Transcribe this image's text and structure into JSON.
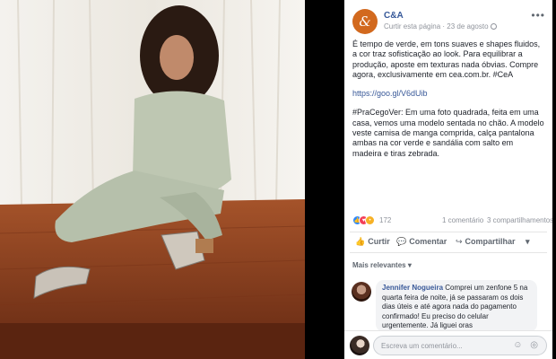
{
  "post": {
    "page_name": "C&A",
    "logo_glyph": "&",
    "follow_label": "Curtir esta página",
    "date": "23 de agosto",
    "separator": " · ",
    "text_paragraphs": [
      "É tempo de verde, em tons suaves e shapes fluidos, a cor traz sofisticação ao look. Para equilibrar a produção, aposte em texturas nada óbvias. Compre agora, exclusivamente em cea.com.br. #CeA",
      "https://goo.gl/V6dUib",
      "#PraCegoVer: Em uma foto quadrada, feita em uma casa, vemos uma modelo sentada no chão. A modelo veste camisa de manga comprida, calça pantalona ambas na cor verde e sandália com salto em madeira e tiras zebrada."
    ],
    "reactions_count": "172",
    "comments_count": "1 comentário",
    "shares_count": "3 compartilhamentos"
  },
  "actions": {
    "like": "Curtir",
    "comment": "Comentar",
    "share": "Compartilhar",
    "more": "▾"
  },
  "comments": {
    "sort_label": "Mais relevantes ▾",
    "items": [
      {
        "author": "Jennifer Nogueira",
        "text": "Comprei um zenfone 5 na quarta feira de noite, já se passaram os dois dias úteis e até agora nada do pagamento confirmado! Eu preciso do celular urgentemente. Já liguei oras"
      }
    ],
    "input_placeholder": "Escreva um comentário...",
    "input_icons": "☺ ◎"
  },
  "icons": {
    "menu": "•••",
    "like": "👍",
    "comment": "💬",
    "share": "↪"
  },
  "colors": {
    "brand": "#d2691e",
    "link": "#385898",
    "wall": "#ece8e0",
    "floor": "#8b3e1f",
    "outfit": "#b9c3ae"
  }
}
